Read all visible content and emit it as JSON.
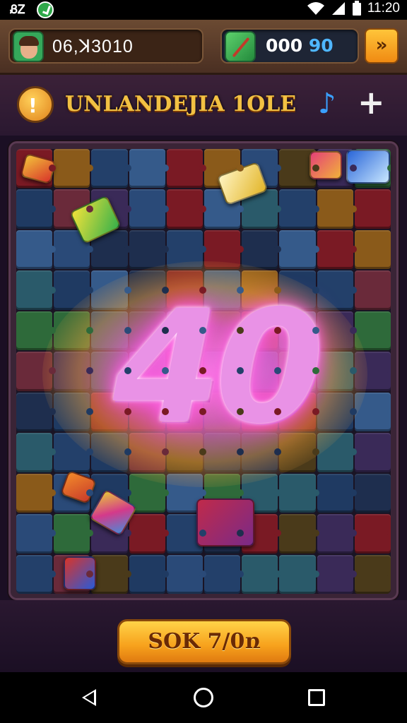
{
  "status_bar": {
    "badge": "ᏰᏃ",
    "time": "11:20"
  },
  "hud": {
    "player_score": "06,ꓘ3010",
    "coin_value_main": "000",
    "coin_value_accent": "90",
    "skip_icon": "double-chevron-right-icon"
  },
  "title_row": {
    "title": "UNLANDEJIA 1OLE",
    "info_icon_glyph": "i"
  },
  "popup": {
    "score_text": "40"
  },
  "action_button": {
    "label": "SOK 7/0ռ"
  },
  "colors": {
    "popup_glow": "#ff6ee8",
    "button_gold": "#f7a11c",
    "title_gold": "#f2c143"
  }
}
